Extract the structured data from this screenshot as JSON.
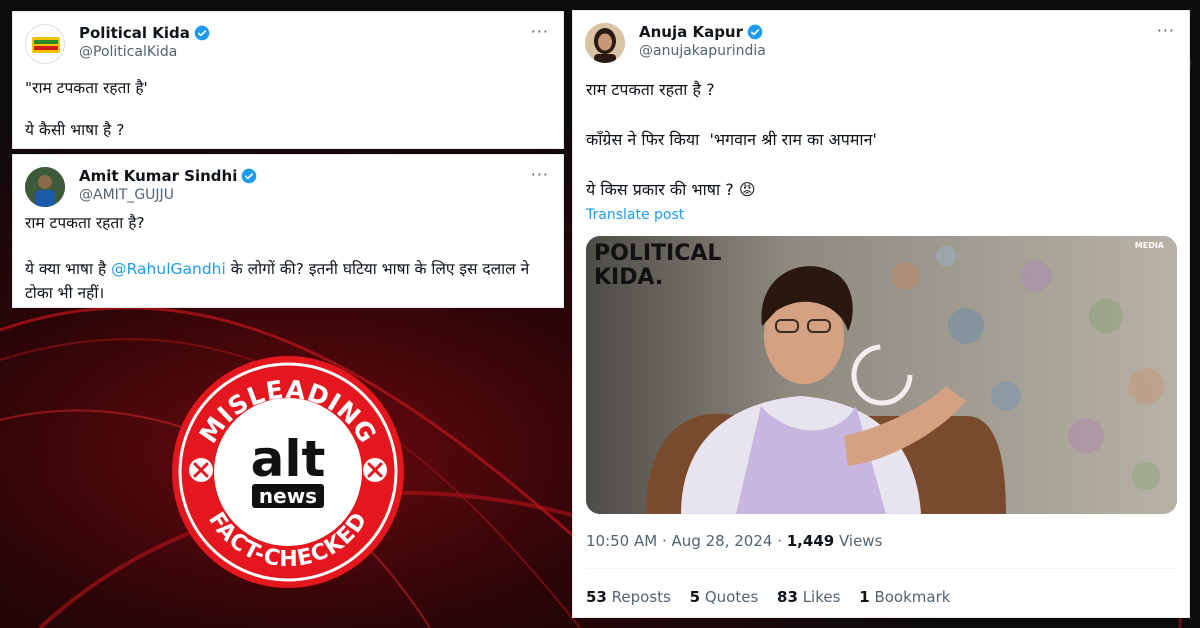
{
  "tweet1": {
    "display_name": "Political Kida",
    "handle": "@PoliticalKida",
    "more": "···",
    "line1": "\"राम टपकता रहता है'",
    "line2": "ये कैसी भाषा है ?"
  },
  "tweet2": {
    "display_name": "Amit Kumar Sindhi",
    "handle": "@AMIT_GUJJU",
    "more": "···",
    "line1": "राम टपकता रहता है?",
    "line2_pre": "ये क्या भाषा है ",
    "mention": "@RahulGandhi",
    "line2_post": " के लोगों की? इतनी घटिया भाषा के लिए इस दलाल ने",
    "line3": "टोका भी नहीं।"
  },
  "tweet3": {
    "display_name": "Anuja Kapur",
    "handle": "@anujakapurindia",
    "more": "···",
    "line1": "राम टपकता रहता है ?",
    "line2": "कॉंग्रेस ने फिर किया  'भगवान श्री राम का अपमान'",
    "line3": "ये किस प्रकार की भाषा ? 😡",
    "translate": "Translate post",
    "video_brand": "POLITICAL\nKIDA.",
    "video_corner": "MEDIA",
    "time": "10:50 AM",
    "date": "Aug 28, 2024",
    "views_count": "1,449",
    "views_label": "Views",
    "reposts_count": "53",
    "reposts_label": "Reposts",
    "quotes_count": "5",
    "quotes_label": "Quotes",
    "likes_count": "83",
    "likes_label": "Likes",
    "bookmarks_count": "1",
    "bookmarks_label": "Bookmark"
  },
  "stamp": {
    "top_text": "MISLEADING",
    "logo_main": "alt",
    "logo_sub": "news",
    "bottom_text": "FACT-CHECKED",
    "color": "#e4161e"
  },
  "colors": {
    "link": "#1d9bf0",
    "muted": "#536471",
    "verified": "#1d9bf0"
  }
}
